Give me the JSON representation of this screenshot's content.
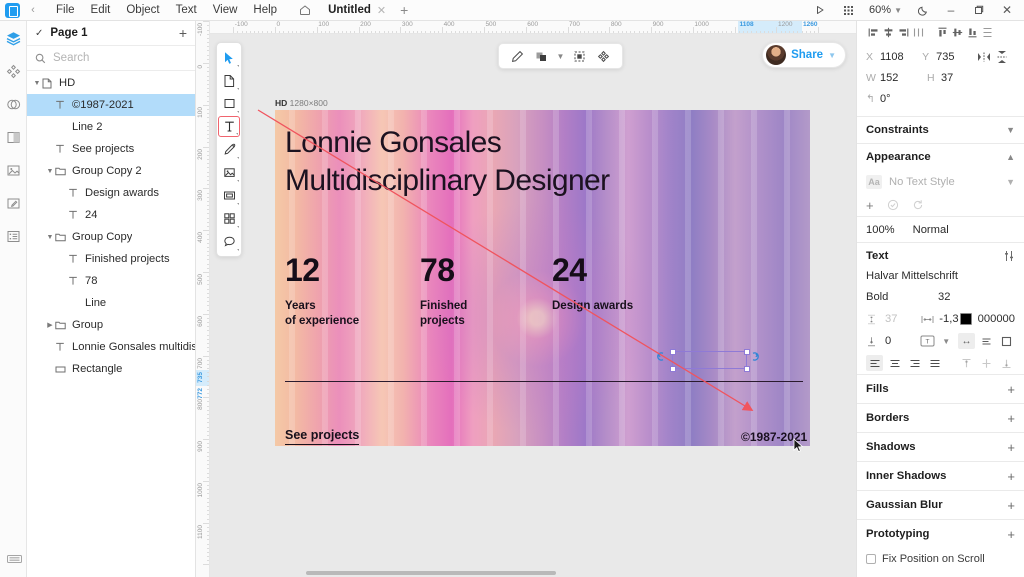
{
  "app": {
    "logo_icon": "app-logo-icon",
    "back_icon": "chevron-left-icon",
    "menus": [
      "File",
      "Edit",
      "Object",
      "Text",
      "View",
      "Help"
    ],
    "home_icon": "home-icon",
    "tab_title": "Untitled",
    "tab_close_icon": "close-icon",
    "new_tab_icon": "plus-icon",
    "right_controls": {
      "play_icon": "play-icon",
      "grid_icon": "grid-icon",
      "zoom_level": "60%",
      "zoom_caret_icon": "chevron-down-icon",
      "theme_icon": "moon-icon",
      "minimize_icon": "minimize-icon",
      "maximize_icon": "maximize-icon",
      "close_icon": "close-icon"
    }
  },
  "rail": {
    "items": [
      {
        "icon": "layers-icon",
        "active": true
      },
      {
        "icon": "components-icon",
        "active": false
      },
      {
        "icon": "symbols-icon",
        "active": false
      },
      {
        "icon": "text-styles-icon",
        "active": false
      },
      {
        "icon": "images-icon",
        "active": false
      },
      {
        "icon": "color-picker-icon",
        "active": false
      },
      {
        "icon": "data-icon",
        "active": false
      }
    ],
    "bottom_icon": "settings-icon"
  },
  "layers_panel": {
    "page_check_icon": "check-icon",
    "page_name": "Page 1",
    "add_page_icon": "plus-icon",
    "search_icon": "search-icon",
    "search_value": "",
    "search_placeholder": "Search",
    "collapse_icon": "collapse-all-icon",
    "items": [
      {
        "label": "HD",
        "icon": "artboard-icon",
        "depth": 0,
        "disclosure": "open",
        "selected": false
      },
      {
        "label": "©1987-2021",
        "icon": "text-icon",
        "depth": 1,
        "disclosure": "",
        "selected": true
      },
      {
        "label": "Line 2",
        "icon": "",
        "depth": 1,
        "disclosure": "",
        "selected": false
      },
      {
        "label": "See projects",
        "icon": "text-icon",
        "depth": 1,
        "disclosure": "",
        "selected": false
      },
      {
        "label": "Group Copy 2",
        "icon": "folder-icon",
        "depth": 1,
        "disclosure": "open",
        "selected": false
      },
      {
        "label": "Design awards",
        "icon": "text-icon",
        "depth": 2,
        "disclosure": "",
        "selected": false
      },
      {
        "label": "24",
        "icon": "text-icon",
        "depth": 2,
        "disclosure": "",
        "selected": false
      },
      {
        "label": "Group Copy",
        "icon": "folder-icon",
        "depth": 1,
        "disclosure": "open",
        "selected": false
      },
      {
        "label": "Finished projects",
        "icon": "text-icon",
        "depth": 2,
        "disclosure": "",
        "selected": false
      },
      {
        "label": "78",
        "icon": "text-icon",
        "depth": 2,
        "disclosure": "",
        "selected": false
      },
      {
        "label": "Line",
        "icon": "",
        "depth": 2,
        "disclosure": "",
        "selected": false
      },
      {
        "label": "Group",
        "icon": "folder-icon",
        "depth": 1,
        "disclosure": "closed",
        "selected": false
      },
      {
        "label": "Lonnie Gonsales multidisciplin",
        "icon": "text-icon",
        "depth": 1,
        "disclosure": "",
        "selected": false
      },
      {
        "label": "Rectangle",
        "icon": "rect-icon",
        "depth": 1,
        "disclosure": "",
        "selected": false
      }
    ]
  },
  "rulers": {
    "horizontal": {
      "labels": [
        "-100",
        "0",
        "100",
        "200",
        "300",
        "400",
        "500",
        "600",
        "700",
        "800",
        "900",
        "1000",
        "1108",
        "1200",
        "1260"
      ],
      "highlight_start": "1108",
      "highlight_end": "1260"
    },
    "vertical": {
      "labels": [
        "-100",
        "0",
        "100",
        "200",
        "300",
        "400",
        "500",
        "600",
        "700",
        "800",
        "900",
        "1000",
        "1100"
      ],
      "highlight_labels": [
        "735",
        "772"
      ]
    }
  },
  "canvas_toolbar": {
    "tools": [
      {
        "icon": "cursor-icon",
        "active": false
      },
      {
        "icon": "artboard-icon",
        "active": false
      },
      {
        "icon": "rectangle-icon",
        "active": false
      },
      {
        "icon": "text-tool-icon",
        "active": true
      },
      {
        "icon": "pen-icon",
        "active": false
      },
      {
        "icon": "image-icon",
        "active": false
      },
      {
        "icon": "slice-icon",
        "active": false
      },
      {
        "icon": "components-icon",
        "active": false
      },
      {
        "icon": "comment-icon",
        "active": false
      }
    ],
    "float_icons": [
      "pencil-icon",
      "boolean-icon",
      "chevron-down-icon",
      "mask-icon",
      "scatter-icon"
    ],
    "share_label": "Share",
    "share_caret_icon": "chevron-down-icon",
    "avatar_icon": "avatar"
  },
  "artboard": {
    "name": "HD",
    "size": "1280×800",
    "heading": "Lonnie Gonsales\nMultidisciplinary Designer",
    "stats": [
      {
        "number": "12",
        "caption": "Years\nof experience"
      },
      {
        "number": "78",
        "caption": "Finished\nprojects"
      },
      {
        "number": "24",
        "caption": "Design awards"
      }
    ],
    "link_label": "See projects",
    "copyright": "©1987-2021",
    "selection": {
      "left_icon": "resize-left-icon",
      "right_icon": "resize-right-icon"
    }
  },
  "inspector": {
    "align_icons": [
      "align-left-icon",
      "align-center-h-icon",
      "align-right-icon",
      "distribute-h-icon",
      "align-top-icon",
      "align-middle-v-icon",
      "align-bottom-icon",
      "distribute-v-icon"
    ],
    "geometry": {
      "x_label": "X",
      "x_value": "1108",
      "y_label": "Y",
      "y_value": "735",
      "w_label": "W",
      "w_value": "152",
      "h_label": "H",
      "h_value": "37",
      "rotation_label": "↰",
      "rotation_value": "0°",
      "flip_h_icon": "flip-horizontal-icon",
      "flip_v_icon": "flip-vertical-icon"
    },
    "constraints": {
      "title": "Constraints",
      "chevron_icon": "chevron-down-icon"
    },
    "appearance": {
      "title": "Appearance",
      "chevron_icon": "chevron-up-icon",
      "style_chip": "Aa",
      "style_name": "No Text Style",
      "style_chevron_icon": "chevron-down-icon",
      "buttons": [
        "plus-icon",
        "check-circle-icon",
        "reset-icon"
      ]
    },
    "blend": {
      "opacity": "100%",
      "mode": "Normal"
    },
    "text": {
      "title": "Text",
      "settings_icon": "sliders-icon",
      "font_family": "Halvar Mittelschrift",
      "font_weight": "Bold",
      "font_size": "32",
      "line_height_icon": "line-height-icon",
      "line_height": "37",
      "letter_spacing_icon": "letter-spacing-icon",
      "letter_spacing": "-1,3",
      "color_hex": "000000",
      "paragraph_icon": "paragraph-spacing-icon",
      "paragraph_spacing": "0",
      "transform_icon": "text-transform-icon",
      "transform_caret_icon": "chevron-down-icon",
      "resize_icons": [
        "auto-width-icon",
        "auto-height-icon",
        "fixed-size-icon"
      ],
      "h_align_icons": [
        "text-align-left-icon",
        "text-align-center-icon",
        "text-align-right-icon",
        "text-align-justify-icon"
      ],
      "v_align_icons": [
        "valign-top-icon",
        "valign-middle-icon",
        "valign-bottom-icon"
      ]
    },
    "sections": [
      {
        "title": "Fills",
        "action_icon": "plus-icon"
      },
      {
        "title": "Borders",
        "action_icon": "plus-icon"
      },
      {
        "title": "Shadows",
        "action_icon": "plus-icon"
      },
      {
        "title": "Inner Shadows",
        "action_icon": "plus-icon"
      },
      {
        "title": "Gaussian Blur",
        "action_icon": "plus-icon"
      },
      {
        "title": "Prototyping",
        "action_icon": "plus-icon"
      }
    ],
    "fix_position_label": "Fix Position on Scroll"
  }
}
